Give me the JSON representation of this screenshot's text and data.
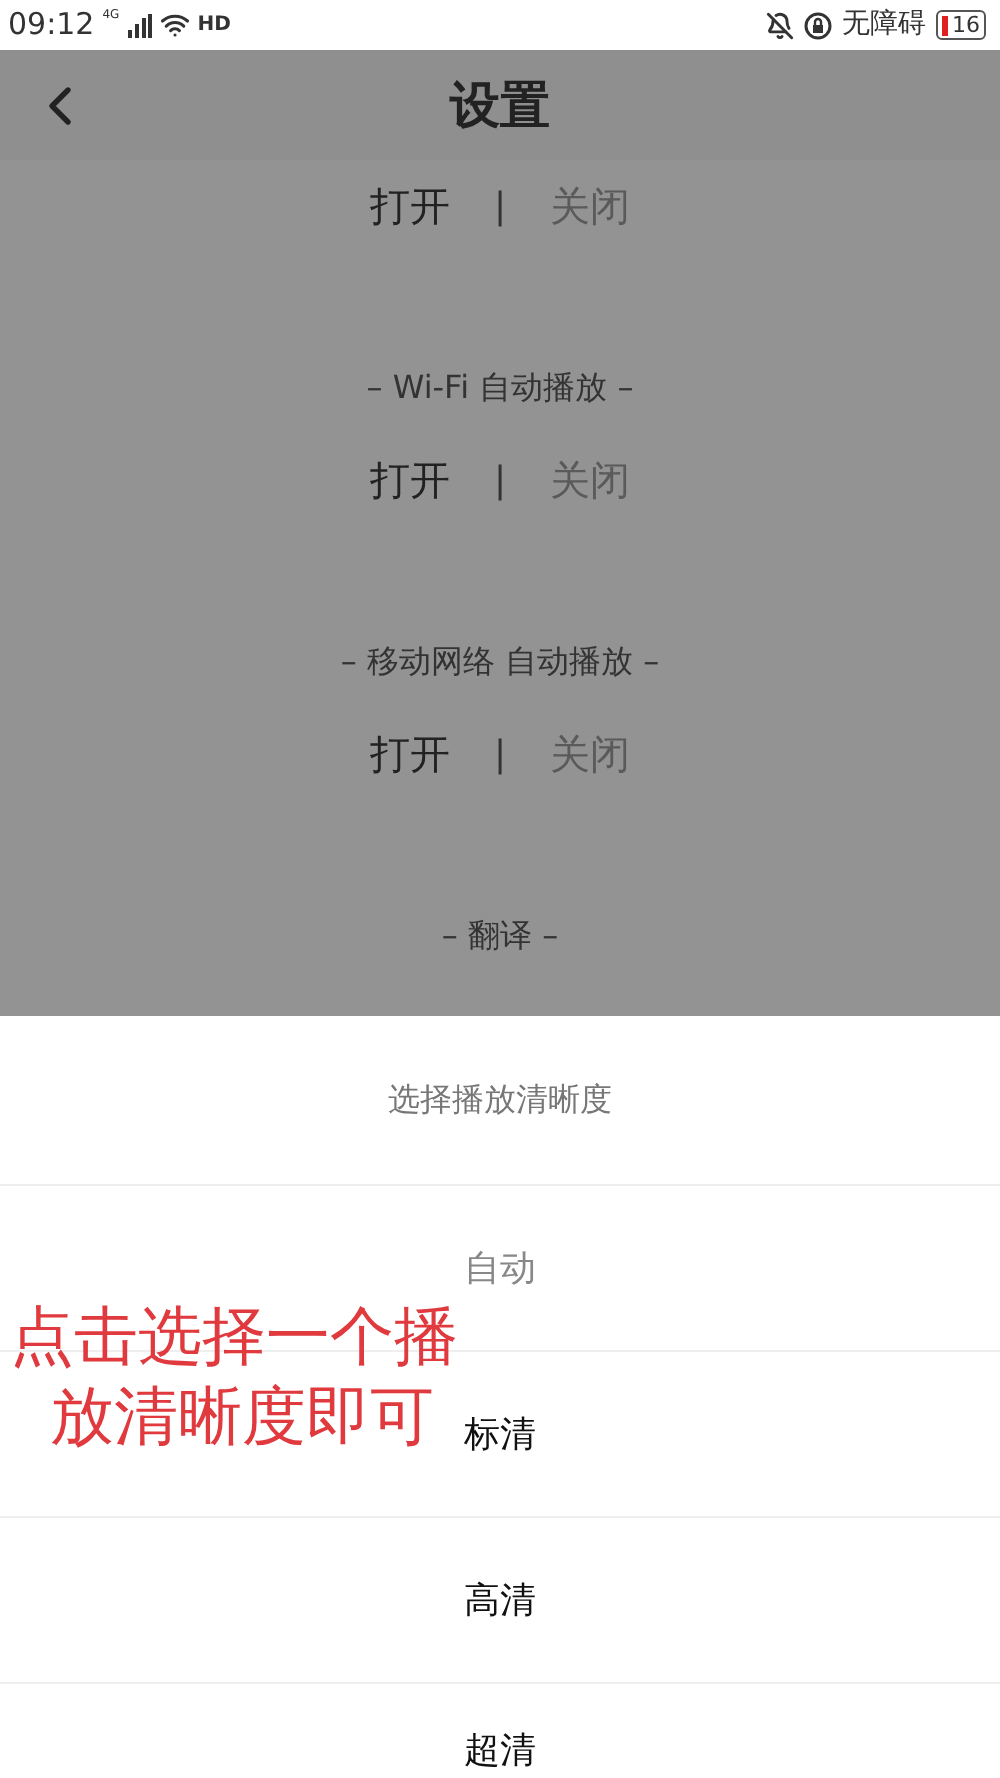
{
  "status_bar": {
    "time": "09:12",
    "network": "4G",
    "hd": "HD",
    "accessibility": "无障碍",
    "battery": "16"
  },
  "header": {
    "title": "设置"
  },
  "settings": [
    {
      "separator": "|",
      "options": [
        {
          "label": "打开",
          "selected": true
        },
        {
          "label": "关闭",
          "selected": false
        }
      ]
    },
    {
      "title": "– Wi-Fi 自动播放 –",
      "separator": "|",
      "options": [
        {
          "label": "打开",
          "selected": true
        },
        {
          "label": "关闭",
          "selected": false
        }
      ]
    },
    {
      "title": "– 移动网络 自动播放 –",
      "separator": "|",
      "options": [
        {
          "label": "打开",
          "selected": true
        },
        {
          "label": "关闭",
          "selected": false
        }
      ]
    },
    {
      "title": "– 翻译 –"
    }
  ],
  "sheet": {
    "title": "选择播放清晰度",
    "options": [
      {
        "label": "自动",
        "selected": true
      },
      {
        "label": "标清",
        "selected": false
      },
      {
        "label": "高清",
        "selected": false
      },
      {
        "label": "超清",
        "selected": false
      }
    ]
  },
  "annotation": {
    "lines": [
      "点击选择一个播",
      "放清晰度即可"
    ]
  }
}
